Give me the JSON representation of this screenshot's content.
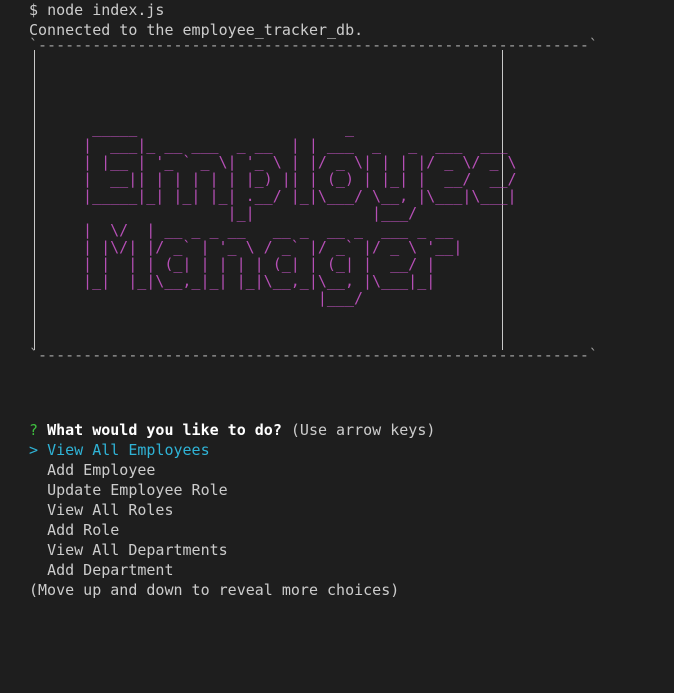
{
  "terminal": {
    "command_prompt": "$",
    "command": "node index.js",
    "connected_message": "Connected to the employee_tracker_db."
  },
  "banner": {
    "title_lines": [
      "Employee",
      "Manager"
    ],
    "ascii_art": "   _____                       _\n  |  ___|_ __ ___  _ __  | | ___  _   _  ___  ___\n  | |__ | '_ ` _ \\| '_ \\ | |/ _ \\| | | |/ _ \\/ _ \\\n  |  __|| | | | | | |_) || | (_) | |_| |  __/  __/\n  |_____|_| |_| |_| .__/ |_|\\___/ \\__, |\\___|\\___|\n                  |_|             |___/\n  |  \\/  | __ _ _ __   __ _  __ _  ___ _ __\n  | |\\/| |/ _` | '_ \\ / _` |/ _` |/ _ \\ '__|\n  | |  | | (_| | | | | (_| | (_| |  __/ |\n  |_|  |_|\\__,_|_| |_|\\__,_|\\__, |\\___|_|\n                            |___/",
    "color": "#b64fb6"
  },
  "menu": {
    "question_mark": "?",
    "question": "What would you like to do?",
    "hint": "(Use arrow keys)",
    "pointer": ">",
    "choices": [
      "View All Employees",
      "Add Employee",
      "Update Employee Role",
      "View All Roles",
      "Add Role",
      "View All Departments",
      "Add Department"
    ],
    "selected_index": 0,
    "footer": "(Move up and down to reveal more choices)"
  },
  "colors": {
    "background": "#1e1e1e",
    "text": "#cccccc",
    "prompt_green": "#3fbf3f",
    "selection_cyan": "#2fb3d6",
    "banner_magenta": "#b64fb6"
  }
}
